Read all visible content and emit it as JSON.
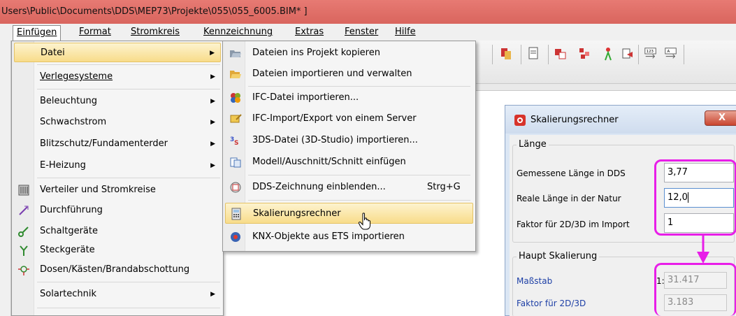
{
  "window": {
    "title": "Users\\Public\\Documents\\DDS\\MEP73\\Projekte\\055\\055_6005.BIM* ]"
  },
  "menubar": {
    "items": [
      {
        "label": "Einfügen"
      },
      {
        "label": "Format"
      },
      {
        "label": "Stromkreis"
      },
      {
        "label": "Kennzeichnung"
      },
      {
        "label": "Extras"
      },
      {
        "label": "Fenster"
      },
      {
        "label": "Hilfe"
      }
    ]
  },
  "insert_menu": {
    "items": [
      {
        "label": "Datei",
        "icon": "none",
        "submenu": true
      },
      {
        "label": "Verlegesysteme",
        "icon": "none",
        "submenu": true
      },
      {
        "label": "Beleuchtung",
        "icon": "none",
        "submenu": true
      },
      {
        "label": "Schwachstrom",
        "icon": "none",
        "submenu": true
      },
      {
        "label": "Blitzschutz/Fundamenterder",
        "icon": "none",
        "submenu": true
      },
      {
        "label": "E-Heizung",
        "icon": "none",
        "submenu": true
      },
      {
        "label": "Verteiler und Stromkreise",
        "icon": "distribution-board-icon",
        "submenu": false
      },
      {
        "label": "Durchführung",
        "icon": "penetration-icon",
        "submenu": false
      },
      {
        "label": "Schaltgeräte",
        "icon": "switch-icon",
        "submenu": false
      },
      {
        "label": "Steckgeräte",
        "icon": "socket-icon",
        "submenu": false
      },
      {
        "label": "Dosen/Kästen/Brandabschottung",
        "icon": "box-icon",
        "submenu": false
      },
      {
        "label": "Solartechnik",
        "icon": "none",
        "submenu": true
      }
    ],
    "highlighted": "Datei"
  },
  "datei_submenu": {
    "items": [
      {
        "label": "Dateien ins Projekt kopieren",
        "icon": "copy-folder-icon",
        "shortcut": ""
      },
      {
        "label": "Dateien importieren und verwalten",
        "icon": "open-folder-icon",
        "shortcut": ""
      },
      {
        "label": "IFC-Datei importieren...",
        "icon": "ifc-icon",
        "shortcut": ""
      },
      {
        "label": "IFC-Import/Export von einem Server",
        "icon": "ifc-server-icon",
        "shortcut": ""
      },
      {
        "label": "3DS-Datei (3D-Studio) importieren...",
        "icon": "3ds-icon",
        "shortcut": ""
      },
      {
        "label": "Modell/Auschnitt/Schnitt einfügen",
        "icon": "model-insert-icon",
        "shortcut": ""
      },
      {
        "label": "DDS-Zeichnung einblenden...",
        "icon": "dds-drawing-icon",
        "shortcut": "Strg+G"
      },
      {
        "label": "Skalierungsrechner",
        "icon": "calculator-icon",
        "shortcut": ""
      },
      {
        "label": "KNX-Objekte aus ETS importieren",
        "icon": "knx-icon",
        "shortcut": ""
      }
    ],
    "highlighted": "Skalierungsrechner"
  },
  "dialog": {
    "title": "Skalierungsrechner",
    "close_label": "X",
    "group_length": {
      "label": "Länge",
      "measured_label": "Gemessene Länge in DDS",
      "measured_value": "3,77",
      "real_label": "Reale Länge in der Natur",
      "real_value": "12,0",
      "factor_label": "Faktor für 2D/3D im Import",
      "factor_value": "1"
    },
    "group_scale": {
      "label": "Haupt Skalierung",
      "scale_label": "Maßstab",
      "scale_prefix": "1:",
      "scale_value": "31.417",
      "factor_label": "Faktor für  2D/3D",
      "factor_value": "3.183"
    }
  },
  "colors": {
    "annotation": "#e81ee8",
    "menu_highlight": "#f8dc8a",
    "title_bar": "#df6d66",
    "link_label": "#1d3fa6"
  }
}
